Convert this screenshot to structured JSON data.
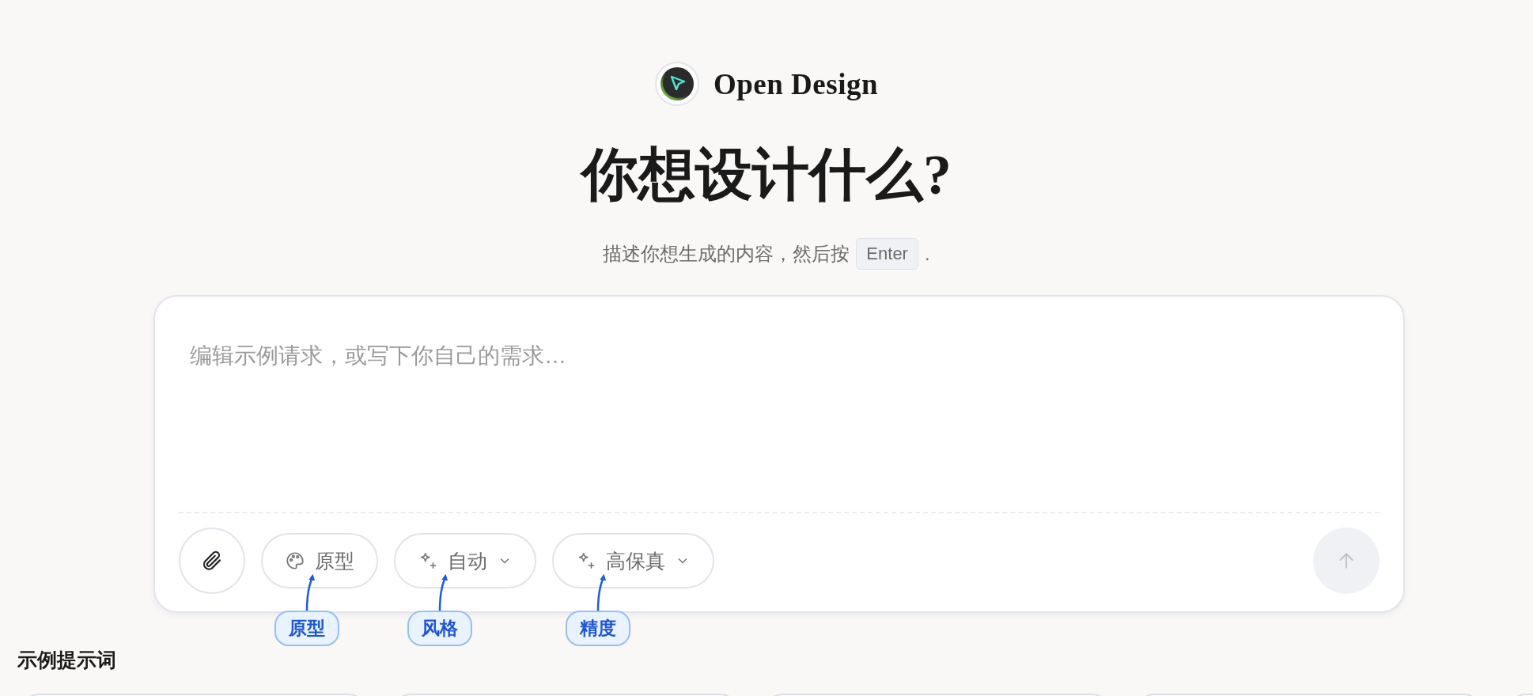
{
  "brand": {
    "name": "Open Design"
  },
  "heading": "你想设计什么?",
  "subtitle": {
    "text": "描述你想生成的内容，然后按",
    "key": "Enter",
    "end": "."
  },
  "prompt": {
    "placeholder": "编辑示例请求，或写下你自己的需求…"
  },
  "toolbar": [
    {
      "kind": "attach"
    },
    {
      "kind": "palette",
      "label": "原型"
    },
    {
      "kind": "sparkle",
      "label": "自动"
    },
    {
      "kind": "sparkle",
      "label": "高保真"
    }
  ],
  "send": {
    "disabled": true
  },
  "annotations": [
    {
      "label": "原型"
    },
    {
      "label": "风格"
    },
    {
      "label": "精度"
    }
  ],
  "examples": {
    "title": "示例提示词"
  }
}
